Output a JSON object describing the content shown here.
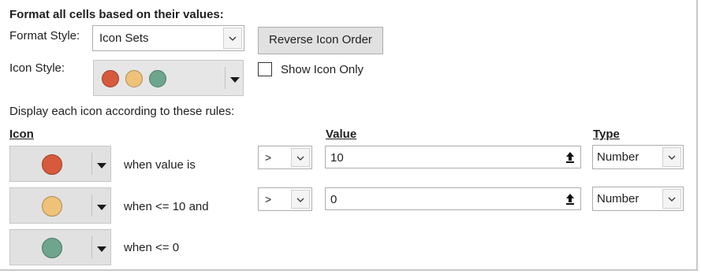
{
  "title": "Format all cells based on their values:",
  "format_style": {
    "label": "Format Style:",
    "value": "Icon Sets"
  },
  "reverse_button": "Reverse Icon Order",
  "icon_style": {
    "label": "Icon Style:",
    "icons": [
      "red-circle-icon",
      "yellow-circle-icon",
      "green-circle-icon"
    ]
  },
  "show_icon_only": {
    "label": "Show Icon Only",
    "checked": false
  },
  "rules_caption": "Display each icon according to these rules:",
  "headers": {
    "icon": "Icon",
    "value": "Value",
    "type": "Type"
  },
  "rules": [
    {
      "icon": "red-circle-icon",
      "color": "#d85a3c",
      "text": "when value is",
      "operator": ">",
      "value": "10",
      "type": "Number"
    },
    {
      "icon": "yellow-circle-icon",
      "color": "#efc27a",
      "text": "when <= 10 and",
      "operator": ">",
      "value": "0",
      "type": "Number"
    },
    {
      "icon": "green-circle-icon",
      "color": "#6ea58d",
      "text": "when <= 0"
    }
  ],
  "colors": {
    "red": "#d85a3c",
    "yellow": "#efc27a",
    "green": "#6ea58d",
    "button_bg": "#e1e1e1"
  }
}
